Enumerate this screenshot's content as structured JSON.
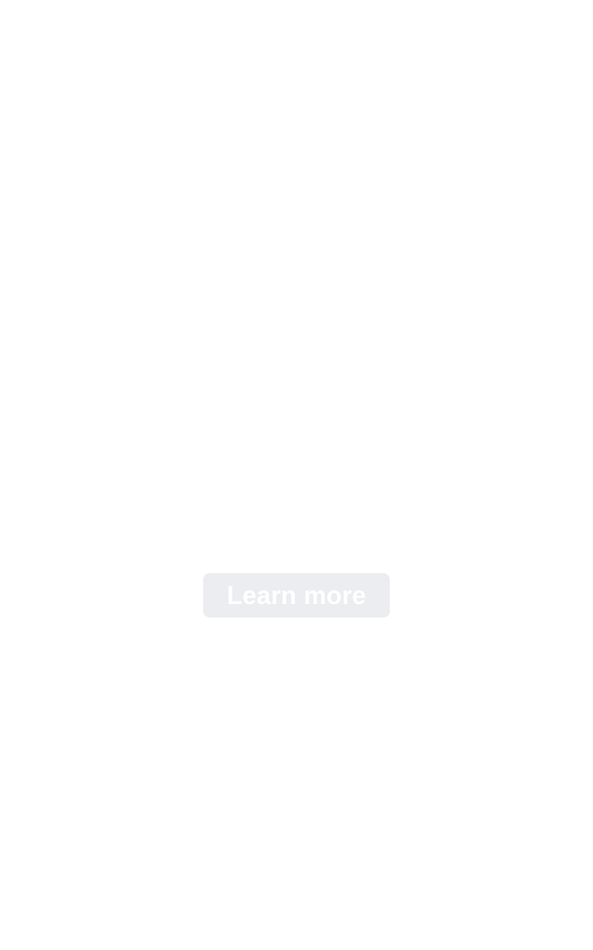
{
  "cta": {
    "label": "Learn more",
    "background_color": "#ebedf0",
    "text_color": "#ffffff"
  }
}
